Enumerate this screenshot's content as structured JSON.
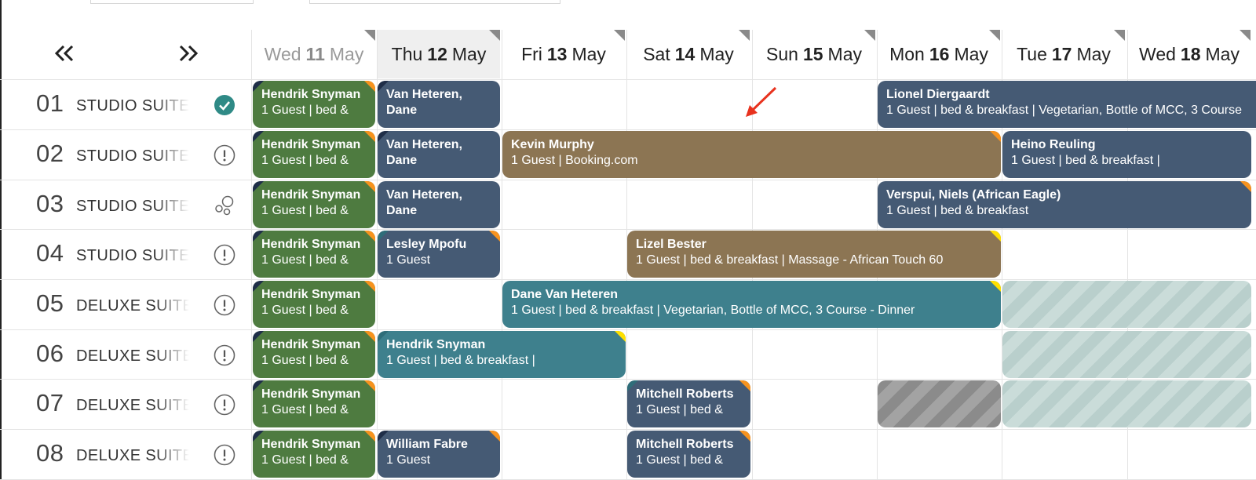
{
  "nav": {
    "prev_icon": "double-chevron-left-icon",
    "next_icon": "double-chevron-right-icon"
  },
  "days": [
    {
      "dow": "Wed",
      "day": "11",
      "month": "May",
      "state": "faded"
    },
    {
      "dow": "Thu",
      "day": "12",
      "month": "May",
      "state": "today"
    },
    {
      "dow": "Fri",
      "day": "13",
      "month": "May",
      "state": "normal"
    },
    {
      "dow": "Sat",
      "day": "14",
      "month": "May",
      "state": "normal"
    },
    {
      "dow": "Sun",
      "day": "15",
      "month": "May",
      "state": "normal"
    },
    {
      "dow": "Mon",
      "day": "16",
      "month": "May",
      "state": "normal"
    },
    {
      "dow": "Tue",
      "day": "17",
      "month": "May",
      "state": "normal"
    },
    {
      "dow": "Wed",
      "day": "18",
      "month": "May",
      "state": "normal"
    }
  ],
  "rooms": [
    {
      "number": "01",
      "name": "STUDIO SUITE",
      "status_icon": "check-circle-icon"
    },
    {
      "number": "02",
      "name": "STUDIO SUITE",
      "status_icon": "alert-circle-icon"
    },
    {
      "number": "03",
      "name": "STUDIO SUITE",
      "status_icon": "bubbles-icon"
    },
    {
      "number": "04",
      "name": "STUDIO SUITE",
      "status_icon": "alert-circle-icon"
    },
    {
      "number": "05",
      "name": "DELUXE SUITE",
      "status_icon": "alert-circle-icon"
    },
    {
      "number": "06",
      "name": "DELUXE SUITE",
      "status_icon": "alert-circle-icon"
    },
    {
      "number": "07",
      "name": "DELUXE SUITE",
      "status_icon": "alert-circle-icon"
    },
    {
      "number": "08",
      "name": "DELUXE SUITE",
      "status_icon": "alert-circle-icon"
    }
  ],
  "bookings": [
    {
      "id": "b1",
      "guest": "Hendrik Snyman",
      "detail": "1 Guest | bed &",
      "color": "#4e7b40"
    },
    {
      "id": "b2",
      "guest": "Van Heteren, Dane",
      "detail": "",
      "color": "#455a74"
    },
    {
      "id": "b3",
      "guest": "Lionel Diergaardt",
      "detail": "1 Guest | bed & breakfast | Vegetarian, Bottle of MCC, 3 Course",
      "color": "#455a74"
    },
    {
      "id": "b4",
      "guest": "Hendrik Snyman",
      "detail": "1 Guest | bed &",
      "color": "#4e7b40"
    },
    {
      "id": "b5",
      "guest": "Van Heteren, Dane",
      "detail": "",
      "color": "#455a74"
    },
    {
      "id": "b6",
      "guest": "Kevin Murphy",
      "detail": "1 Guest | Booking.com",
      "color": "#8c7553"
    },
    {
      "id": "b7",
      "guest": "Heino Reuling",
      "detail": "1 Guest | bed & breakfast |",
      "color": "#455a74"
    },
    {
      "id": "b8",
      "guest": "Hendrik Snyman",
      "detail": "1 Guest | bed &",
      "color": "#4e7b40"
    },
    {
      "id": "b9",
      "guest": "Van Heteren, Dane",
      "detail": "",
      "color": "#455a74"
    },
    {
      "id": "b10",
      "guest": "Verspui, Niels (African Eagle)",
      "detail": "1 Guest | bed & breakfast",
      "color": "#455a74"
    },
    {
      "id": "b11",
      "guest": "Hendrik Snyman",
      "detail": "1 Guest | bed &",
      "color": "#4e7b40"
    },
    {
      "id": "b12",
      "guest": "Lesley Mpofu",
      "detail": "1 Guest",
      "color": "#455a74"
    },
    {
      "id": "b13",
      "guest": "Lizel Bester",
      "detail": "1 Guest | bed & breakfast | Massage - African Touch 60",
      "color": "#8c7553"
    },
    {
      "id": "b14",
      "guest": "Hendrik Snyman",
      "detail": "1 Guest | bed &",
      "color": "#4e7b40"
    },
    {
      "id": "b15",
      "guest": "Dane Van Heteren",
      "detail": "1 Guest | bed & breakfast | Vegetarian, Bottle of MCC, 3 Course - Dinner",
      "color": "#3e808d"
    },
    {
      "id": "b16",
      "guest": "Hendrik Snyman",
      "detail": "1 Guest | bed &",
      "color": "#4e7b40"
    },
    {
      "id": "b17",
      "guest": "Hendrik Snyman",
      "detail": "1 Guest | bed & breakfast |",
      "color": "#3e808d"
    },
    {
      "id": "b18",
      "guest": "Hendrik Snyman",
      "detail": "1 Guest | bed &",
      "color": "#4e7b40"
    },
    {
      "id": "b19",
      "guest": "Mitchell Roberts",
      "detail": "1 Guest | bed &",
      "color": "#455a74"
    },
    {
      "id": "b20",
      "guest": "Hendrik Snyman",
      "detail": "1 Guest | bed &",
      "color": "#4e7b40"
    },
    {
      "id": "b21",
      "guest": "William Fabre",
      "detail": "1 Guest",
      "color": "#455a74"
    },
    {
      "id": "b22",
      "guest": "Mitchell Roberts",
      "detail": "1 Guest | bed &",
      "color": "#455a74"
    }
  ]
}
